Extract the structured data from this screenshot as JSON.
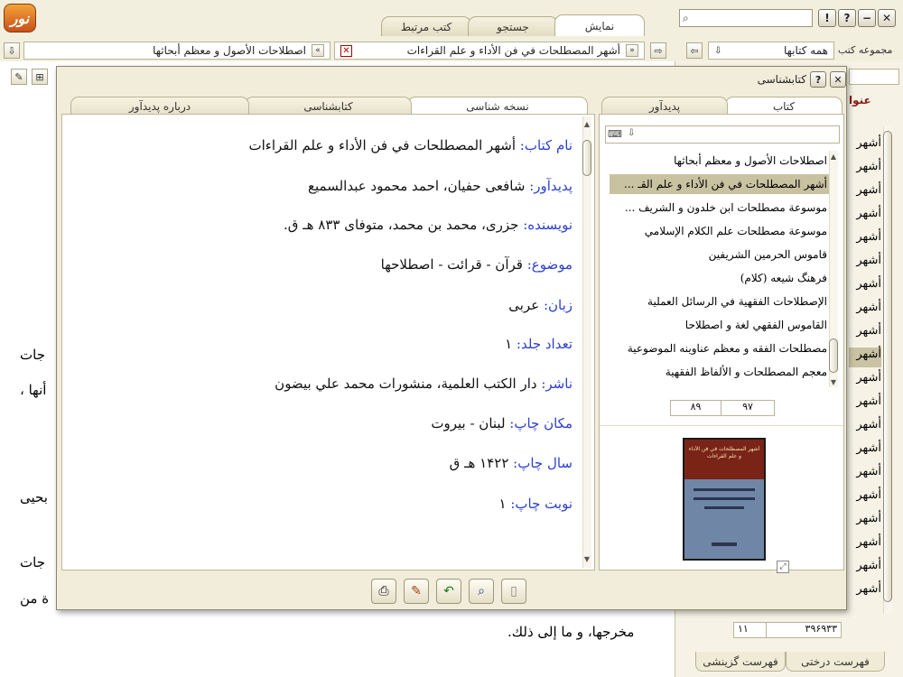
{
  "tabs": [
    {
      "label": "نمایش",
      "active": true
    },
    {
      "label": "جستجو",
      "active": false
    },
    {
      "label": "کتب مرتبط",
      "active": false
    }
  ],
  "toolbar": {
    "collection_label": "مجموعه کتب",
    "collection_value": "همه کتابها",
    "open_book_1": "أشهر المصطلحات في فن الأداء و علم القراءات",
    "open_book_2": "اصطلاحات الأصول و معظم أبحاثها"
  },
  "main_text": {
    "fragment_1": "جات",
    "fragment_2": "، أنها",
    "fragment_3": "بحيى",
    "fragment_4": "جات",
    "fragment_5": "ة من",
    "bottom_line": "مخرجها، و ما إلى ذلك."
  },
  "right_panel": {
    "header_fragment": "عنوا",
    "item_label": "أشهر",
    "footer_left": "۱۱",
    "footer_right": "۳۹۶۹۳۳",
    "bottom_tab_1": "فهرست درختی",
    "bottom_tab_2": "فهرست گزینشی"
  },
  "dialog": {
    "title": "کتابشناسی",
    "help_label": "?",
    "close_label": "✕",
    "tabs_right": [
      {
        "label": "کتاب",
        "active": true
      },
      {
        "label": "پدیدآور",
        "active": false
      }
    ],
    "tabs_left": [
      {
        "label": "نسخه شناسی",
        "active": true
      },
      {
        "label": "کتابشناسی",
        "active": false
      },
      {
        "label": "درباره پدیدآور",
        "active": false
      }
    ],
    "fields": [
      {
        "label": "نام کتاب:",
        "value": "أشهر المصطلحات في فن الأداء و علم القراءات"
      },
      {
        "label": "پدیدآور:",
        "value": "شافعى حفيان، احمد محمود عبدالسميع"
      },
      {
        "label": "نویسنده:",
        "value": "جزرى، محمد بن محمد، متوفاى ۸۳۳ هـ ق."
      },
      {
        "label": "موضوع:",
        "value": "قرآن - قرائت - اصطلاحها"
      },
      {
        "label": "زبان:",
        "value": "عربى"
      },
      {
        "label": "تعداد جلد:",
        "value": "۱"
      },
      {
        "label": "ناشر:",
        "value": "دار الكتب العلمية، منشورات محمد علي بيضون"
      },
      {
        "label": "مکان چاپ:",
        "value": "لبنان - بيروت"
      },
      {
        "label": "سال چاپ:",
        "value": "۱۴۲۲ هـ ق"
      },
      {
        "label": "نوبت چاپ:",
        "value": "۱"
      }
    ],
    "book_list": [
      "اصطلاحات الأصول و معظم أبحاثها",
      "أشهر المصطلحات في فن الأداء و علم القـ ...",
      "موسوعة مصطلحات ابن خلدون و الشريف ...",
      "موسوعة مصطلحات علم الكلام الإسلامي",
      "قاموس الحرمين الشريفين",
      "فرهنگ شيعه (كلام)",
      "الإصطلاحات الفقهية في الرسائل العملية",
      "القاموس الفقهي لغة و اصطلاحا",
      "مصطلحات الفقه و معظم عناوينه الموضوعية",
      "معجم المصطلحات و الألفاظ الفقهية"
    ],
    "selected_book_index": 1,
    "pager_current": "۹۷",
    "pager_total": "۸۹",
    "cover": {
      "title_line": "أشهر المصطلحات في فن الأداء و علم القراءات",
      "colors": {
        "top": "#7a2418",
        "body": "#6f86a6",
        "border": "#1a1a1a"
      }
    }
  },
  "colors": {
    "label_blue": "#2c3fd0",
    "selection": "#c9c2a1",
    "chrome_bg": "#f3efde"
  }
}
